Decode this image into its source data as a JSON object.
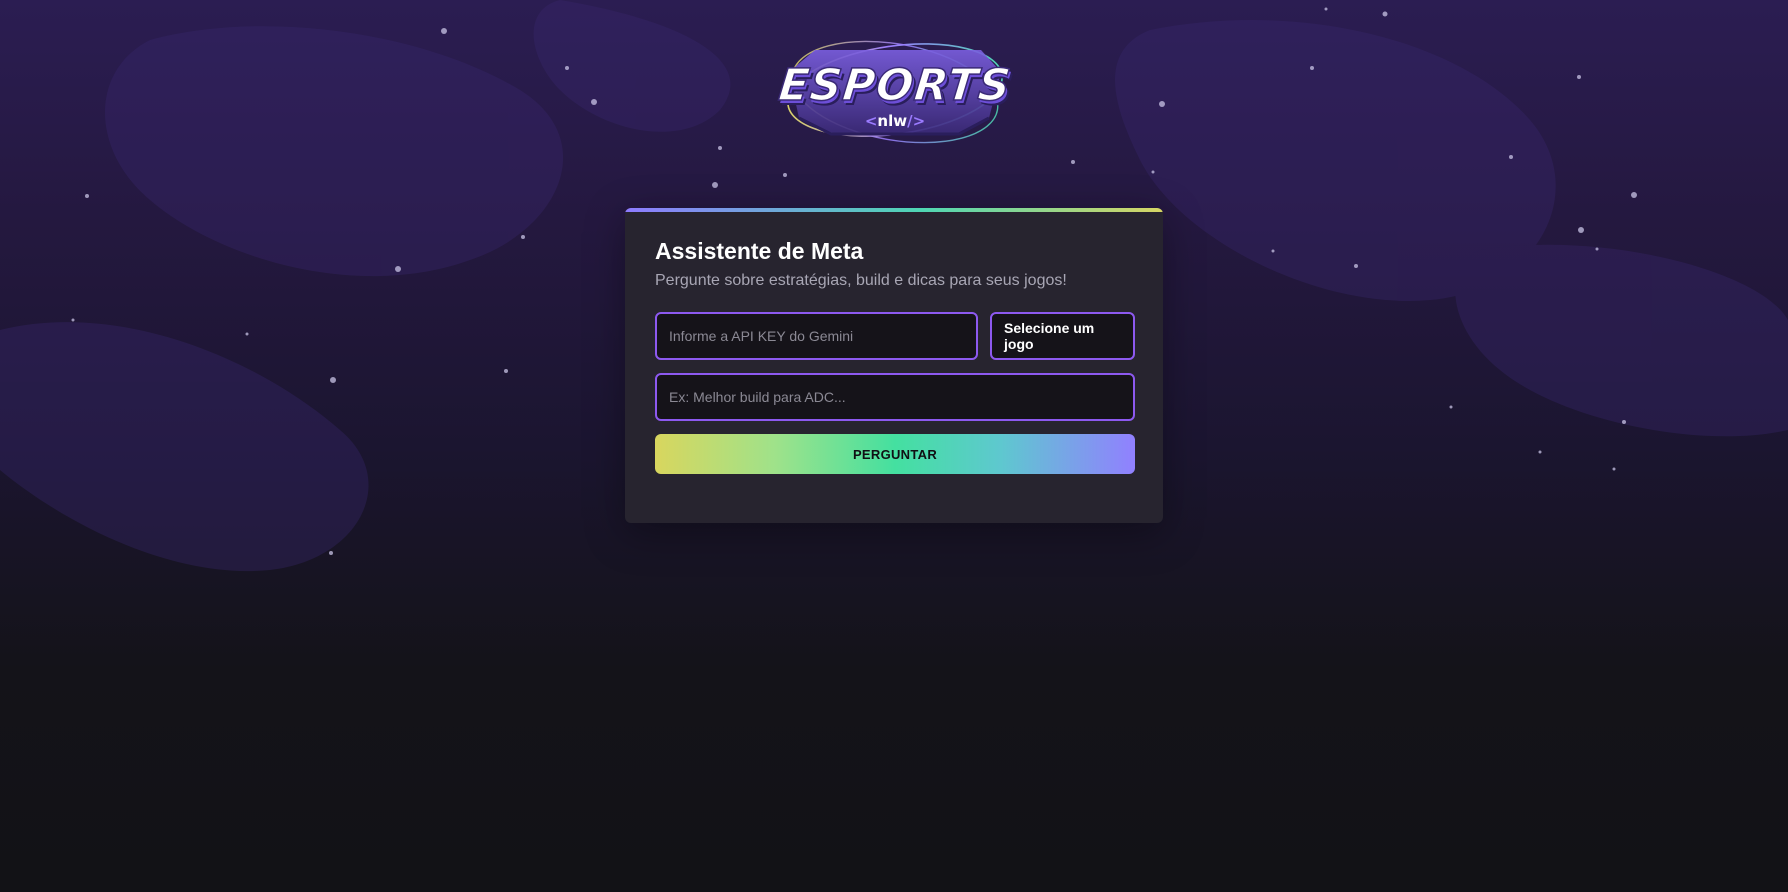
{
  "logo": {
    "wordmark": "ESPORTS",
    "tag_open": "<",
    "tag_text": "nlw",
    "tag_close": "/>"
  },
  "assistant": {
    "title": "Assistente de Meta",
    "subtitle": "Pergunte sobre estratégias, build e dicas para seus jogos!",
    "api_key_placeholder": "Informe a API KEY do Gemini",
    "api_key_value": "",
    "game_select_label": "Selecione um jogo",
    "question_placeholder": "Ex: Melhor build para ADC...",
    "question_value": "",
    "ask_button_label": "PERGUNTAR"
  },
  "colors": {
    "background_top": "#2b1d52",
    "background_bottom": "#121216",
    "card": "#27242f",
    "field_border": "#8d59f0",
    "field_bg": "#151319",
    "accent_yellow": "#d8d65e",
    "accent_green": "#44e0a0",
    "accent_purple": "#9180ff"
  }
}
